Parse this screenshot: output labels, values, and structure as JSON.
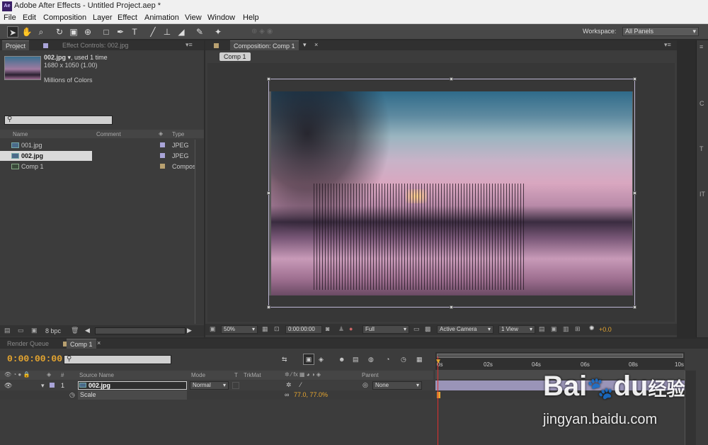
{
  "window": {
    "app_icon": "Ae",
    "title": "Adobe After Effects - Untitled Project.aep *"
  },
  "menu": [
    "File",
    "Edit",
    "Composition",
    "Layer",
    "Effect",
    "Animation",
    "View",
    "Window",
    "Help"
  ],
  "toolbar": {
    "tools": [
      "selection-tool",
      "hand-tool",
      "zoom-tool",
      "rotation-tool",
      "camera-tool",
      "pan-behind-tool",
      "rectangle-tool",
      "pen-tool",
      "type-tool",
      "brush-tool",
      "clone-stamp-tool",
      "eraser-tool",
      "roto-brush-tool",
      "puppet-pin-tool"
    ],
    "workspace_label": "Workspace:",
    "workspace_value": "All Panels"
  },
  "project_panel": {
    "tabs": [
      "Project",
      "Effect Controls: 002.jpg"
    ],
    "selected_file": "002.jpg",
    "used": ", used 1 time",
    "dims": "1680 x 1050 (1.00)",
    "colors": "Millions of Colors",
    "columns": {
      "name": "Name",
      "comment": "Comment",
      "type": "Type"
    },
    "items": [
      {
        "name": "001.jpg",
        "type": "JPEG",
        "color": "#a9a4d8"
      },
      {
        "name": "002.jpg",
        "type": "JPEG",
        "color": "#a9a4d8"
      },
      {
        "name": "Comp 1",
        "type": "Compos",
        "color": "#b8a070"
      }
    ],
    "bpc": "8 bpc"
  },
  "composition_panel": {
    "tab": "Composition: Comp 1",
    "chip": "Comp 1",
    "zoom": "50%",
    "timecode": "0:00:00:00",
    "resolution": "Full",
    "camera": "Active Camera",
    "view": "1 View",
    "exposure": "+0.0"
  },
  "timeline_panel": {
    "tabs": [
      "Render Queue",
      "Comp 1"
    ],
    "timecode": "0:00:00:00",
    "columns": {
      "source": "Source Name",
      "mode": "Mode",
      "t": "T",
      "trkmat": "TrkMat",
      "parent": "Parent"
    },
    "layer": {
      "index": "1",
      "name": "002.jpg",
      "mode": "Normal",
      "parent": "None"
    },
    "property": {
      "name": "Scale",
      "value": "77.0, 77.0%"
    },
    "ruler": [
      "0s",
      "02s",
      "04s",
      "06s",
      "08s",
      "10s"
    ]
  },
  "watermark": {
    "brand_a": "Bai",
    "brand_b": "du",
    "brand_cn": "经验",
    "url": "jingyan.baidu.com"
  }
}
